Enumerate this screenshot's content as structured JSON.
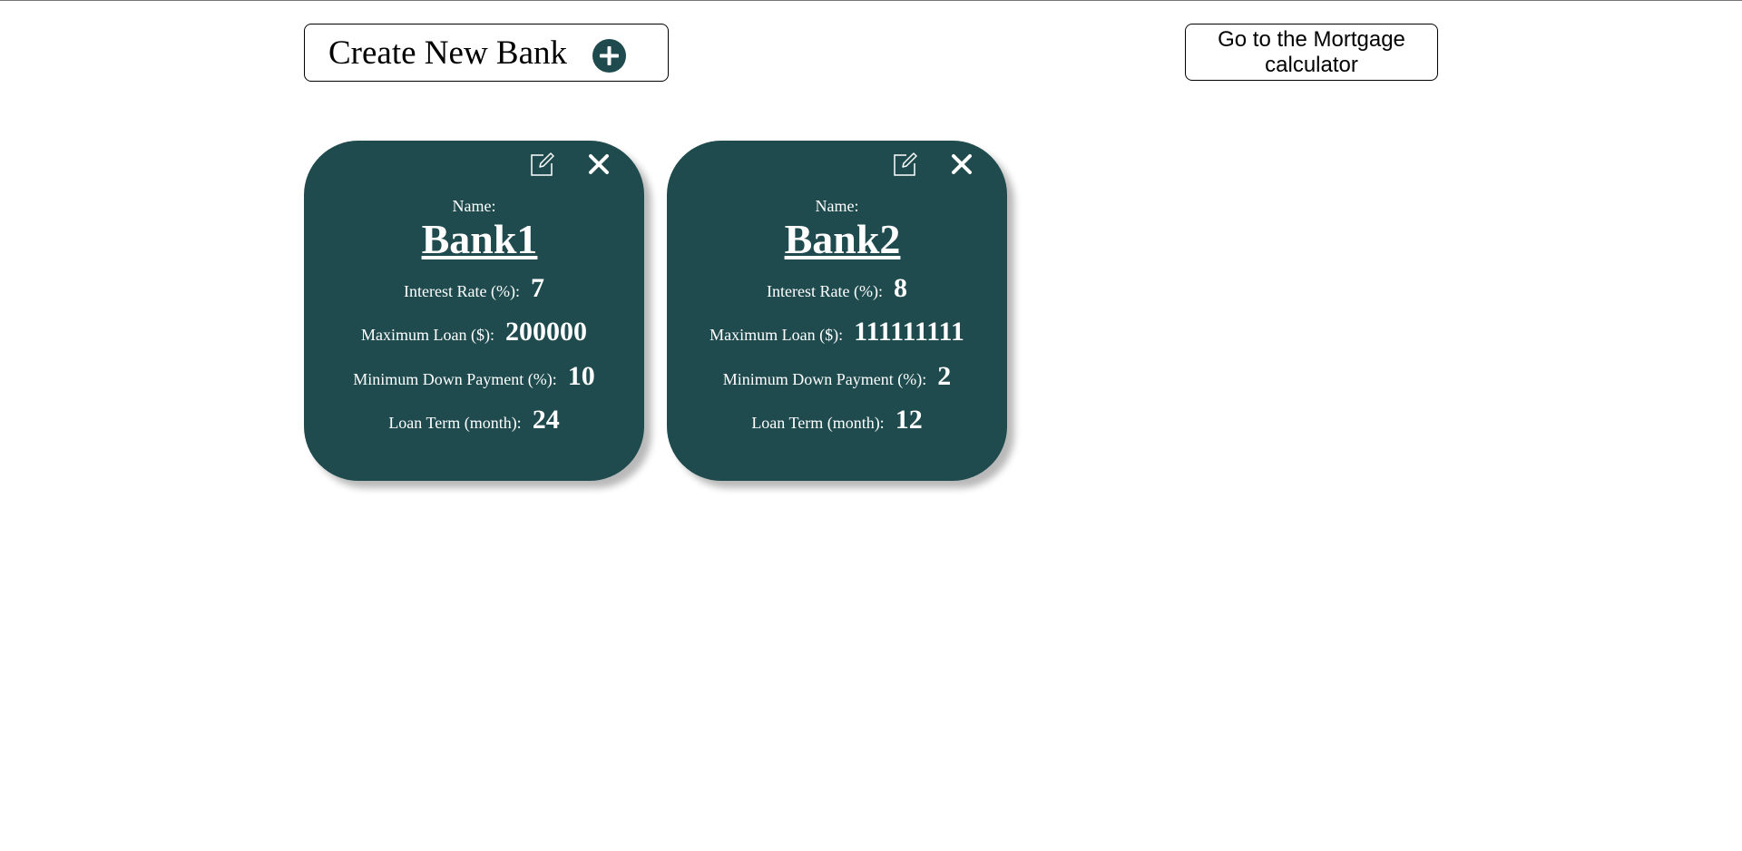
{
  "header": {
    "create_label": "Create New Bank",
    "mortgage_label": "Go to the Mortgage calculator"
  },
  "labels": {
    "name": "Name:",
    "interest_rate": "Interest Rate (%):",
    "max_loan": "Maximum Loan ($):",
    "min_down": "Minimum Down Payment (%):",
    "loan_term": "Loan Term (month):"
  },
  "banks": [
    {
      "name": "Bank1",
      "interest_rate": "7",
      "max_loan": "200000",
      "min_down": "10",
      "loan_term": "24"
    },
    {
      "name": "Bank2",
      "interest_rate": "8",
      "max_loan": "111111111",
      "min_down": "2",
      "loan_term": "12"
    }
  ],
  "colors": {
    "card_bg": "#1f4b4e",
    "accent": "#1f4b4e",
    "text_on_card": "#ffffff"
  },
  "icons": {
    "create": "plus-circle-icon",
    "edit": "edit-icon",
    "delete": "close-icon"
  }
}
